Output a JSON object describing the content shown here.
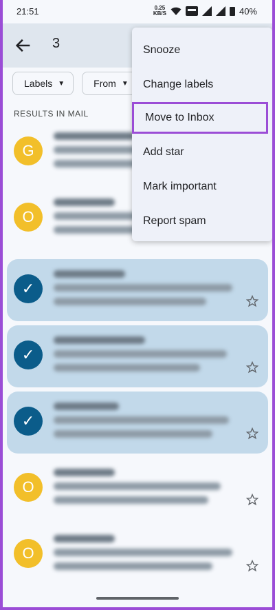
{
  "status_bar": {
    "time": "21:51",
    "speed_value": "0.25",
    "speed_unit": "KB/S",
    "battery": "40%"
  },
  "toolbar": {
    "selected_count": "3"
  },
  "filters": [
    {
      "label": "Labels"
    },
    {
      "label": "From"
    }
  ],
  "section_title": "RESULTS IN MAIL",
  "emails": [
    {
      "avatar": "G",
      "selected": false,
      "avatar_color": "#f2bf2a"
    },
    {
      "avatar": "O",
      "selected": false,
      "avatar_color": "#f2bf2a"
    },
    {
      "avatar": "✓",
      "selected": true,
      "avatar_color": "#0b5c8a"
    },
    {
      "avatar": "✓",
      "selected": true,
      "avatar_color": "#0b5c8a"
    },
    {
      "avatar": "✓",
      "selected": true,
      "avatar_color": "#0b5c8a"
    },
    {
      "avatar": "O",
      "selected": false,
      "avatar_color": "#f2bf2a"
    },
    {
      "avatar": "O",
      "selected": false,
      "avatar_color": "#f2bf2a"
    }
  ],
  "menu": {
    "items": [
      {
        "label": "Snooze"
      },
      {
        "label": "Change labels"
      },
      {
        "label": "Move to Inbox",
        "highlighted": true
      },
      {
        "label": "Add star"
      },
      {
        "label": "Mark important"
      },
      {
        "label": "Report spam"
      }
    ]
  },
  "colors": {
    "highlight_border": "#9b4dd6",
    "selected_row": "#c2d9ea",
    "avatar_yellow": "#f2bf2a",
    "check_blue": "#0b5c8a"
  }
}
